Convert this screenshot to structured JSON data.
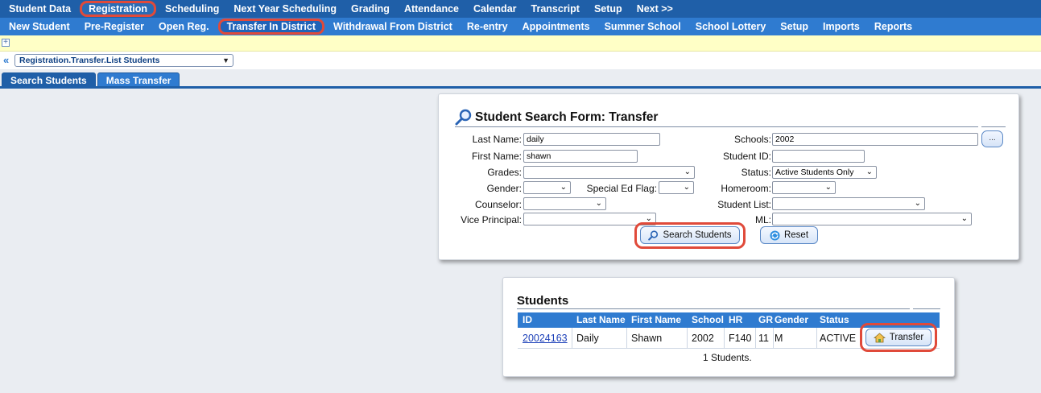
{
  "top_nav": {
    "items": [
      "Student Data",
      "Registration",
      "Scheduling",
      "Next Year Scheduling",
      "Grading",
      "Attendance",
      "Calendar",
      "Transcript",
      "Setup",
      "Next >>"
    ],
    "highlighted": "Registration"
  },
  "sub_nav": {
    "items": [
      "New Student",
      "Pre-Register",
      "Open Reg.",
      "Transfer In District",
      "Withdrawal From District",
      "Re-entry",
      "Appointments",
      "Summer School",
      "School Lottery",
      "Setup",
      "Imports",
      "Reports"
    ],
    "highlighted": "Transfer In District"
  },
  "breadcrumb": {
    "value": "Registration.Transfer.List Students"
  },
  "tabs": [
    "Search Students",
    "Mass Transfer"
  ],
  "search_form": {
    "title": "Student Search Form: Transfer",
    "labels": {
      "last_name": "Last Name:",
      "first_name": "First Name:",
      "grades": "Grades:",
      "gender": "Gender:",
      "special_ed": "Special Ed Flag:",
      "counselor": "Counselor:",
      "vice_principal": "Vice Principal:",
      "schools": "Schools:",
      "student_id": "Student ID:",
      "status": "Status:",
      "homeroom": "Homeroom:",
      "student_list": "Student List:",
      "ml": "ML:"
    },
    "values": {
      "last_name": "daily",
      "first_name": "shawn",
      "grades": "",
      "gender": "",
      "special_ed": "",
      "counselor": "",
      "vice_principal": "",
      "schools": "2002",
      "student_id": "",
      "status": "Active Students Only",
      "homeroom": "",
      "student_list": "",
      "ml": ""
    },
    "dots_label": "...",
    "search_button": "Search Students",
    "reset_button": "Reset"
  },
  "students": {
    "title": "Students",
    "columns": [
      "ID",
      "Last Name",
      "First Name",
      "School",
      "HR",
      "GR",
      "Gender",
      "Status"
    ],
    "rows": [
      {
        "id": "20024163",
        "last_name": "Daily",
        "first_name": "Shawn",
        "school": "2002",
        "hr": "F140",
        "gr": "11",
        "gender": "M",
        "status": "ACTIVE",
        "action": "Transfer"
      }
    ],
    "count_text": "1 Students."
  },
  "colors": {
    "nav_dark": "#1f5fa8",
    "nav_light": "#2f7bd0",
    "highlight": "#e04a3a",
    "banner": "#ffffc6"
  }
}
